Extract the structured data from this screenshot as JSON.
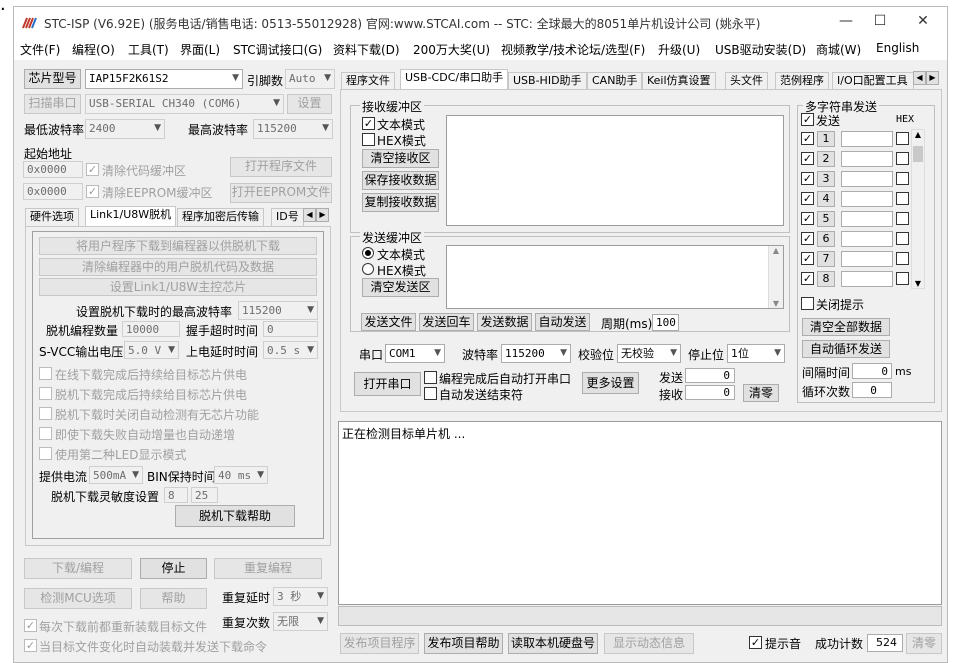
{
  "window": {
    "title": "STC-ISP (V6.92E) (服务电话/销售电话: 0513-55012928) 官网:www.STCAI.com  -- STC: 全球最大的8051单片机设计公司 (姚永平)",
    "minimize": "—",
    "maximize": "☐",
    "close": "✕"
  },
  "menu": [
    "文件(F)",
    "编程(O)",
    "工具(T)",
    "界面(L)",
    "STC调试接口(G)",
    "资料下载(D)",
    "200万大奖(U)",
    "视频教学/技术论坛/选型(F)",
    "升级(U)",
    "USB驱动安装(D)",
    "商城(W)",
    "English"
  ],
  "left": {
    "chip_btn": "芯片型号",
    "chip_value": "IAP15F2K61S2",
    "pin_label": "引脚数",
    "pin_value": "Auto",
    "scan_btn": "扫描串口",
    "port_value": "USB-SERIAL CH340 (COM6)",
    "settings_btn": "设置",
    "min_baud_label": "最低波特率",
    "min_baud": "2400",
    "max_baud_label": "最高波特率",
    "max_baud": "115200",
    "start_addr_label": "起始地址",
    "addr1": "0x0000",
    "addr2": "0x0000",
    "clear_code": "清除代码缓冲区",
    "clear_eeprom": "清除EEPROM缓冲区",
    "open_prog": "打开程序文件",
    "open_eeprom": "打开EEPROM文件",
    "tabs": [
      "硬件选项",
      "Link1/U8W脱机",
      "程序加密后传输",
      "ID号"
    ],
    "offline": {
      "btn1": "将用户程序下载到编程器以供脱机下载",
      "btn2": "清除编程器中的用户脱机代码及数据",
      "btn3": "设置Link1/U8W主控芯片",
      "max_baud_label": "设置脱机下载时的最高波特率",
      "max_baud": "115200",
      "count_label": "脱机编程数量",
      "count": "10000",
      "hs_label": "握手超时时间",
      "hs": "0",
      "svcc_label": "S-VCC输出电压",
      "svcc": "5.0 V",
      "delay_label": "上电延时时间",
      "delay": "0.5 s",
      "checks": [
        "在线下载完成后持续给目标芯片供电",
        "脱机下载完成后持续给目标芯片供电",
        "脱机下载时关闭自动检测有无芯片功能",
        "即使下载失败自动增量也自动递增",
        "使用第二种LED显示模式"
      ],
      "current_label": "提供电流",
      "current": "500mA",
      "bin_label": "BIN保持时间",
      "bin": "40 ms",
      "sens_label": "脱机下载灵敏度设置",
      "sens1": "8",
      "sens2": "25",
      "help_btn": "脱机下载帮助"
    },
    "download_btn": "下载/编程",
    "stop_btn": "停止",
    "reprog_btn": "重复编程",
    "detect_btn": "检测MCU选项",
    "help_btn": "帮助",
    "repeat_delay_label": "重复延时",
    "repeat_delay": "3 秒",
    "repeat_count_label": "重复次数",
    "repeat_count": "无限",
    "check_reload": "每次下载前都重新装载目标文件",
    "check_autoload": "当目标文件变化时自动装载并发送下载命令"
  },
  "right": {
    "tabs": [
      "程序文件",
      "USB-CDC/串口助手",
      "USB-HID助手",
      "CAN助手",
      "Keil仿真设置",
      "头文件",
      "范例程序",
      "I/O口配置工具"
    ],
    "recv": {
      "title": "接收缓冲区",
      "text_mode": "文本模式",
      "hex_mode": "HEX模式",
      "clear": "清空接收区",
      "save": "保存接收数据",
      "copy": "复制接收数据"
    },
    "send": {
      "title": "发送缓冲区",
      "text_mode": "文本模式",
      "hex_mode": "HEX模式",
      "clear": "清空发送区",
      "send_file": "发送文件",
      "send_enter": "发送回车",
      "send_data": "发送数据",
      "auto_send": "自动发送",
      "period_label": "周期(ms)",
      "period": "100"
    },
    "multi": {
      "title": "多字符串发送",
      "send_label": "发送",
      "hex_label": "HEX",
      "rows": [
        "1",
        "2",
        "3",
        "4",
        "5",
        "6",
        "7",
        "8"
      ],
      "close_tip": "关闭提示",
      "clear_all": "清空全部数据",
      "auto_loop": "自动循环发送",
      "interval_label": "间隔时间",
      "interval": "0",
      "interval_unit": "ms",
      "loop_label": "循环次数",
      "loop": "0"
    },
    "serial": {
      "port_label": "串口",
      "port": "COM1",
      "baud_label": "波特率",
      "baud": "115200",
      "parity_label": "校验位",
      "parity": "无校验",
      "stop_label": "停止位",
      "stop": "1位",
      "open_btn": "打开串口",
      "auto_open": "编程完成后自动打开串口",
      "auto_end": "自动发送结束符",
      "more_btn": "更多设置",
      "tx_label": "发送",
      "tx": "0",
      "rx_label": "接收",
      "rx": "0",
      "clear_btn": "清零"
    },
    "log": "正在检测目标单片机 ..."
  },
  "bottom": {
    "publish": "发布项目程序",
    "publish_help": "发布项目帮助",
    "read_disk": "读取本机硬盘号",
    "show_info": "显示动态信息",
    "beep": "提示音",
    "success_label": "成功计数",
    "success": "524",
    "clear": "清零"
  }
}
